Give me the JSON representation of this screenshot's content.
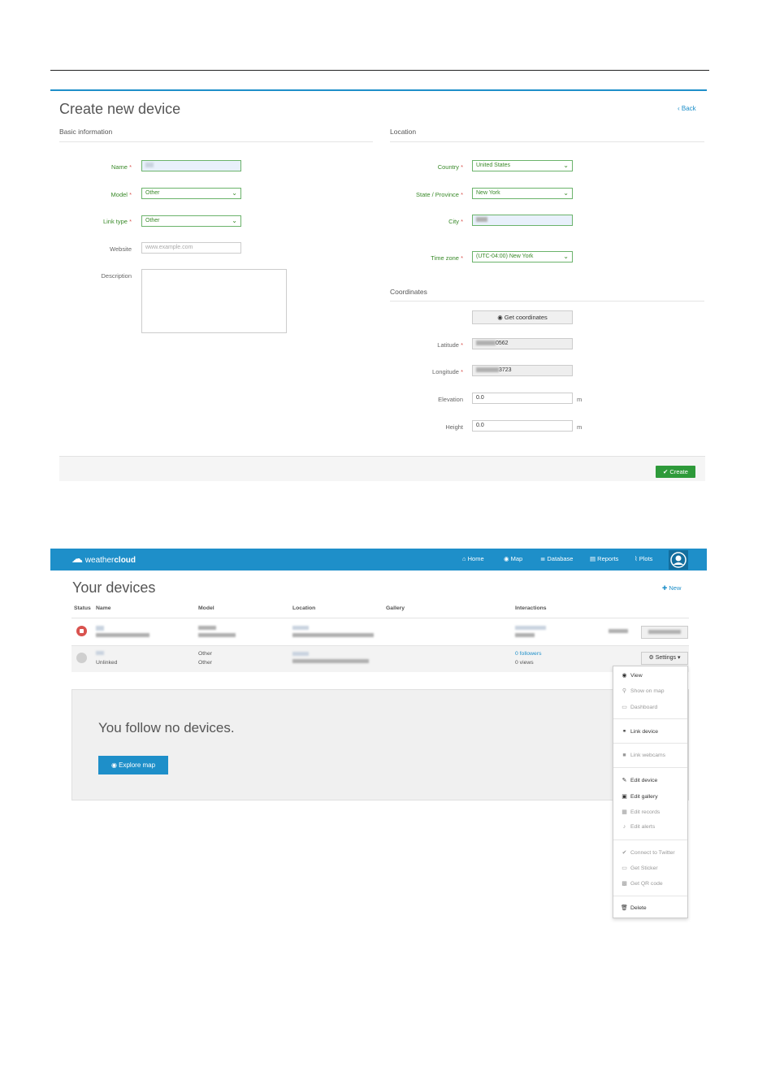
{
  "create_form": {
    "title": "Create new device",
    "back_label": "Back",
    "basic_section": "Basic information",
    "location_section": "Location",
    "coordinates_section": "Coordinates",
    "name_label": "Name",
    "model_label": "Model",
    "model_value": "Other",
    "link_type_label": "Link type",
    "link_type_value": "Other",
    "website_label": "Website",
    "website_placeholder": "www.example.com",
    "description_label": "Description",
    "country_label": "Country",
    "country_value": "United States",
    "state_label": "State / Province",
    "state_value": "New York",
    "city_label": "City",
    "timezone_label": "Time zone",
    "timezone_value": "(UTC-04:00) New York",
    "get_coords_label": "Get coordinates",
    "latitude_label": "Latitude",
    "latitude_value": "0562",
    "longitude_label": "Longitude",
    "longitude_value": "3723",
    "elevation_label": "Elevation",
    "elevation_value": "0.0",
    "height_label": "Height",
    "height_value": "0.0",
    "unit_m": "m",
    "create_label": "Create",
    "required_mark": "*"
  },
  "navbar": {
    "brand_light": "weather",
    "brand_bold": "cloud",
    "items": [
      "Home",
      "Map",
      "Database",
      "Reports",
      "Plots"
    ]
  },
  "devices": {
    "title": "Your devices",
    "new_label": "New",
    "headers": [
      "Status",
      "Name",
      "Model",
      "Location",
      "Gallery",
      "Interactions"
    ],
    "row2": {
      "status_text": "Unlinked",
      "model_line1": "Other",
      "model_line2": "Other",
      "followers": "0 followers",
      "views": "0 views",
      "settings_label": "Settings"
    }
  },
  "follow": {
    "text": "You follow no devices.",
    "button_label": "Explore map"
  },
  "settings_menu": {
    "items": [
      "View",
      "Show on map",
      "Dashboard",
      "Link device",
      "Link webcams",
      "Edit device",
      "Edit gallery",
      "Edit records",
      "Edit alerts",
      "Connect to Twitter",
      "Get Sticker",
      "Get QR code",
      "Delete"
    ]
  },
  "colors": {
    "accent": "#1e8fc9",
    "label_green": "#3a8a2a",
    "create_green": "#2e9a3a",
    "required_red": "#d9534f"
  }
}
